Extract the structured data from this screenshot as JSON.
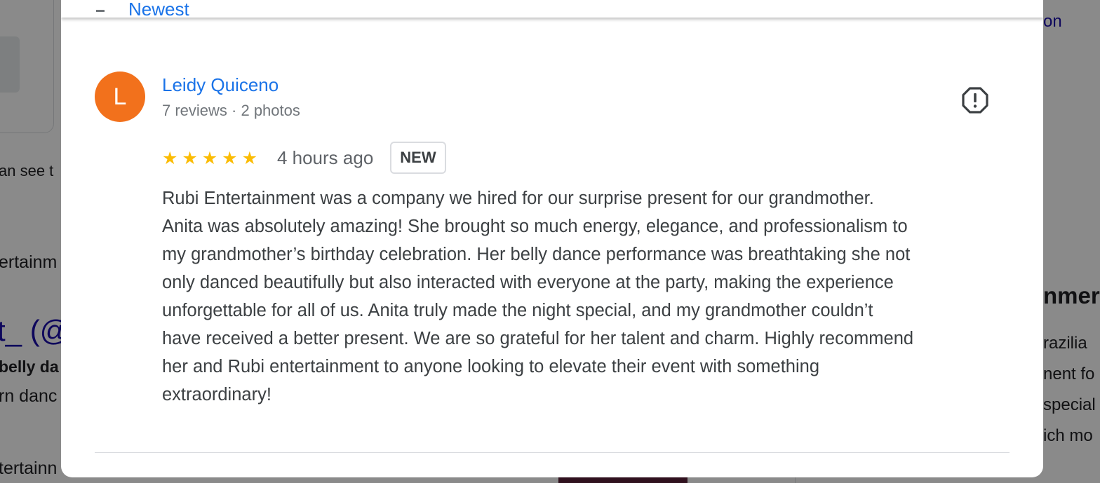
{
  "background": {
    "top_right_text": "on",
    "left_fragments": [
      "an see t",
      "ertainm",
      "t_ (@",
      "belly da",
      "rn danc",
      "tertainn"
    ],
    "right_fragments": [
      "nmer",
      "razilia",
      "nent fo",
      "special",
      "ich mo"
    ]
  },
  "modal": {
    "sort_label_partial": "Newest"
  },
  "review": {
    "avatar_letter": "L",
    "reviewer_name": "Leidy Quiceno",
    "reviewer_meta": "7 reviews · 2 photos",
    "rating": 5,
    "rating_max": 5,
    "time_ago": "4 hours ago",
    "badge": "NEW",
    "text_lines": [
      "Rubi Entertainment was a company we hired for our surprise present for our grandmother.",
      "Anita was absolutely amazing! She brought so much energy, elegance, and professionalism to",
      "my grandmother’s birthday celebration. Her belly dance performance was breathtaking she not",
      "only danced beautifully but also interacted with everyone at the party, making the experience",
      "unforgettable for all of us. Anita truly made the night special, and my grandmother couldn’t",
      "have received a better present. We are so grateful for her talent and charm. Highly recommend",
      "her and Rubi entertainment to anyone looking to elevate their event with something",
      "extraordinary!"
    ]
  },
  "icons": {
    "report": "report-flag-icon",
    "star": "star-icon"
  },
  "colors": {
    "avatar_bg": "#f2711c",
    "name_link": "#1a73e8",
    "star": "#fbbc04",
    "text": "#3c4043",
    "meta": "#70757a"
  }
}
